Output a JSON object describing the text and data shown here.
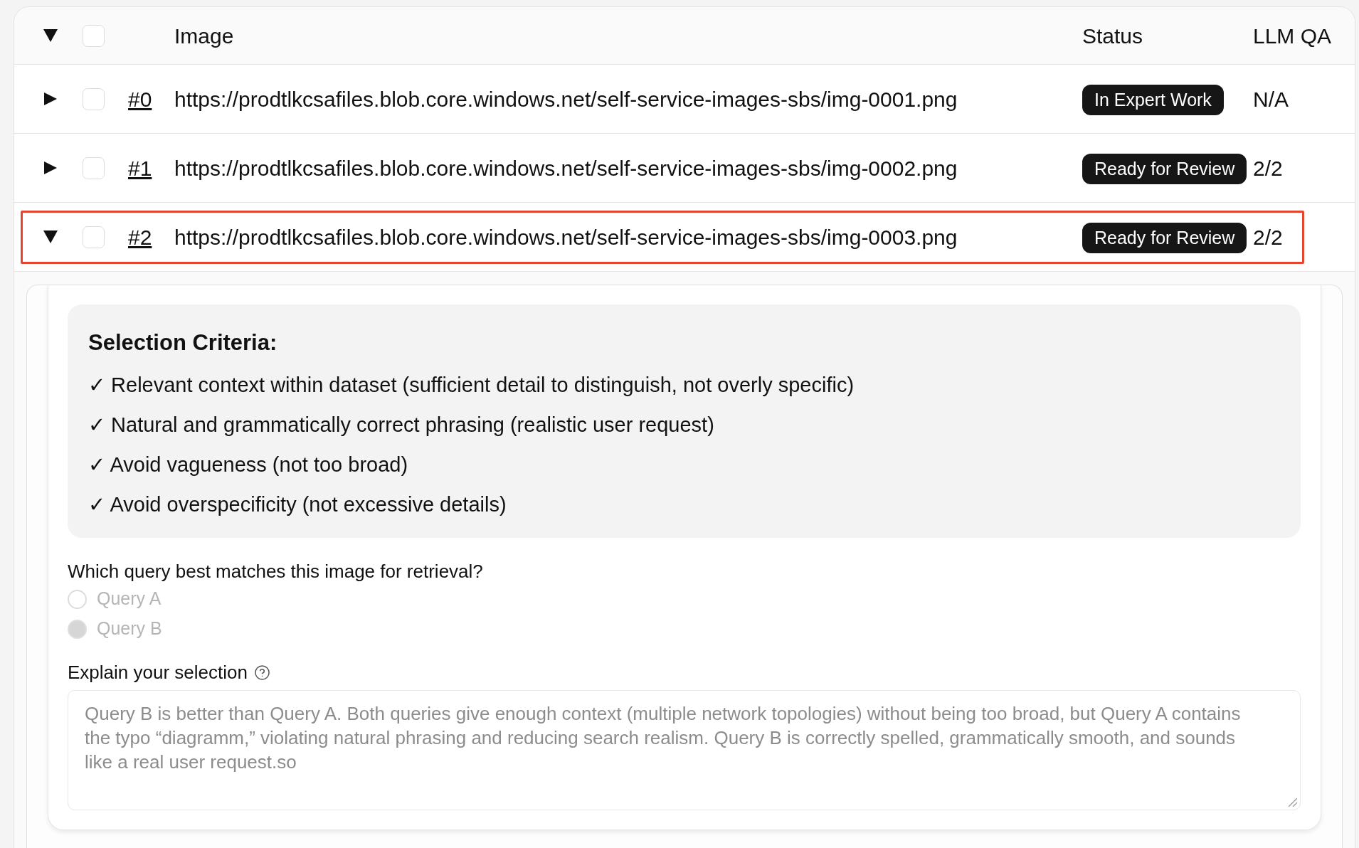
{
  "table": {
    "header": {
      "expanded": true,
      "checked": false,
      "columns": [
        "Image",
        "Status",
        "LLM QA"
      ]
    },
    "rows": [
      {
        "expanded": false,
        "checked": false,
        "highlighted": false,
        "number": "#0",
        "image": "https://prodtlkcsafiles.blob.core.windows.net/self-service-images-sbs/img-0001.png",
        "status": "In Expert Work",
        "llm_qa": "N/A"
      },
      {
        "expanded": false,
        "checked": false,
        "highlighted": false,
        "number": "#1",
        "image": "https://prodtlkcsafiles.blob.core.windows.net/self-service-images-sbs/img-0002.png",
        "status": "Ready for Review",
        "llm_qa": "2/2"
      },
      {
        "expanded": true,
        "checked": false,
        "highlighted": true,
        "number": "#2",
        "image": "https://prodtlkcsafiles.blob.core.windows.net/self-service-images-sbs/img-0003.png",
        "status": "Ready for Review",
        "llm_qa": "2/2",
        "details": {
          "criteria": {
            "title": "Selection Criteria:",
            "items": [
              "✓ Relevant context within dataset (sufficient detail to distinguish, not overly specific)",
              "✓ Natural and grammatically correct phrasing (realistic user request)",
              "✓ Avoid vagueness (not too broad)",
              "✓ Avoid overspecificity (not excessive details)"
            ]
          },
          "question": {
            "label": "Which query best matches this image for retrieval?",
            "disabled": true,
            "options": [
              {
                "label": "Query A",
                "selected": false
              },
              {
                "label": "Query B",
                "selected": true
              }
            ]
          },
          "explanation": {
            "label": "Explain your selection",
            "disabled": true,
            "value": "Query B is better than Query A. Both queries give enough context (multiple network topologies) without being too broad, but Query A contains the typo “diagramm,” violating natural phrasing and reducing search realism. Query B is correctly spelled, grammatically smooth, and sounds like a real user request.so"
          }
        }
      }
    ]
  }
}
